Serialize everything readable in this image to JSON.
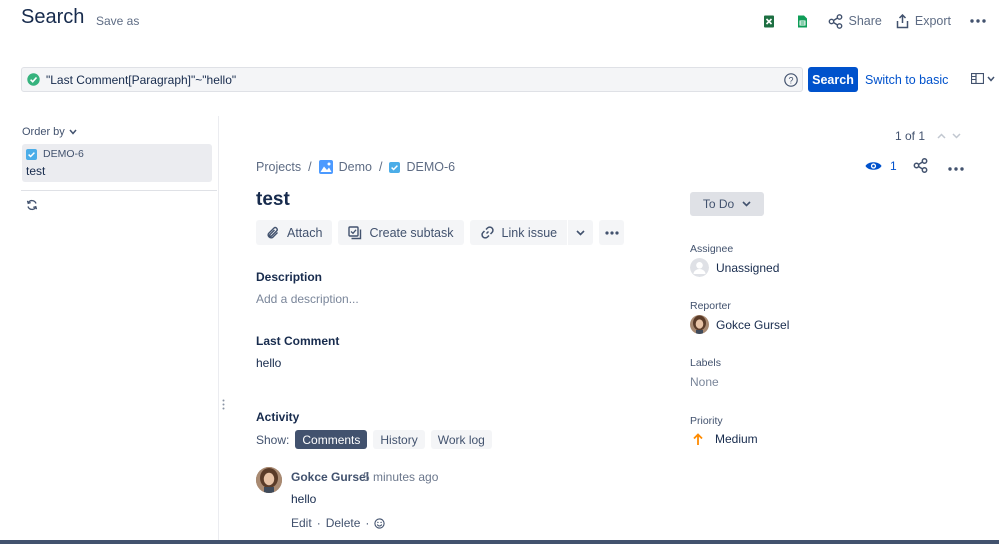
{
  "header": {
    "title": "Search",
    "save_as": "Save as",
    "share_label": "Share",
    "export_label": "Export"
  },
  "search": {
    "jql": "\"Last Comment[Paragraph]\"~\"hello\"",
    "search_label": "Search",
    "switch_label": "Switch to basic"
  },
  "list": {
    "order_by": "Order by",
    "items": [
      {
        "key": "DEMO-6",
        "summary": "test"
      }
    ]
  },
  "pager": {
    "text": "1 of 1"
  },
  "issue": {
    "breadcrumb": {
      "projects": "Projects",
      "project": "Demo",
      "key": "DEMO-6",
      "sep": "/"
    },
    "title": "test",
    "toolbar": {
      "attach": "Attach",
      "subtask": "Create subtask",
      "link": "Link issue"
    },
    "description": {
      "heading": "Description",
      "placeholder": "Add a description..."
    },
    "last_comment": {
      "heading": "Last Comment",
      "value": "hello"
    },
    "activity": {
      "heading": "Activity",
      "show_label": "Show:",
      "tabs": [
        "Comments",
        "History",
        "Work log"
      ]
    },
    "comment": {
      "author": "Gokce Gursel",
      "time": "5 minutes ago",
      "body": "hello",
      "edit": "Edit",
      "delete": "Delete",
      "dot": "·"
    }
  },
  "sidebar": {
    "watch_count": "1",
    "status": "To Do",
    "assignee_label": "Assignee",
    "assignee": "Unassigned",
    "reporter_label": "Reporter",
    "reporter": "Gokce Gursel",
    "labels_label": "Labels",
    "labels": "None",
    "priority_label": "Priority",
    "priority": "Medium"
  },
  "colors": {
    "primary": "#0052cc",
    "text": "#172b4d",
    "subtle": "#42526e",
    "success": "#36b37e",
    "priority_medium": "#ff8b00",
    "excel": "#1d6f42",
    "sheets": "#0f9d58"
  }
}
